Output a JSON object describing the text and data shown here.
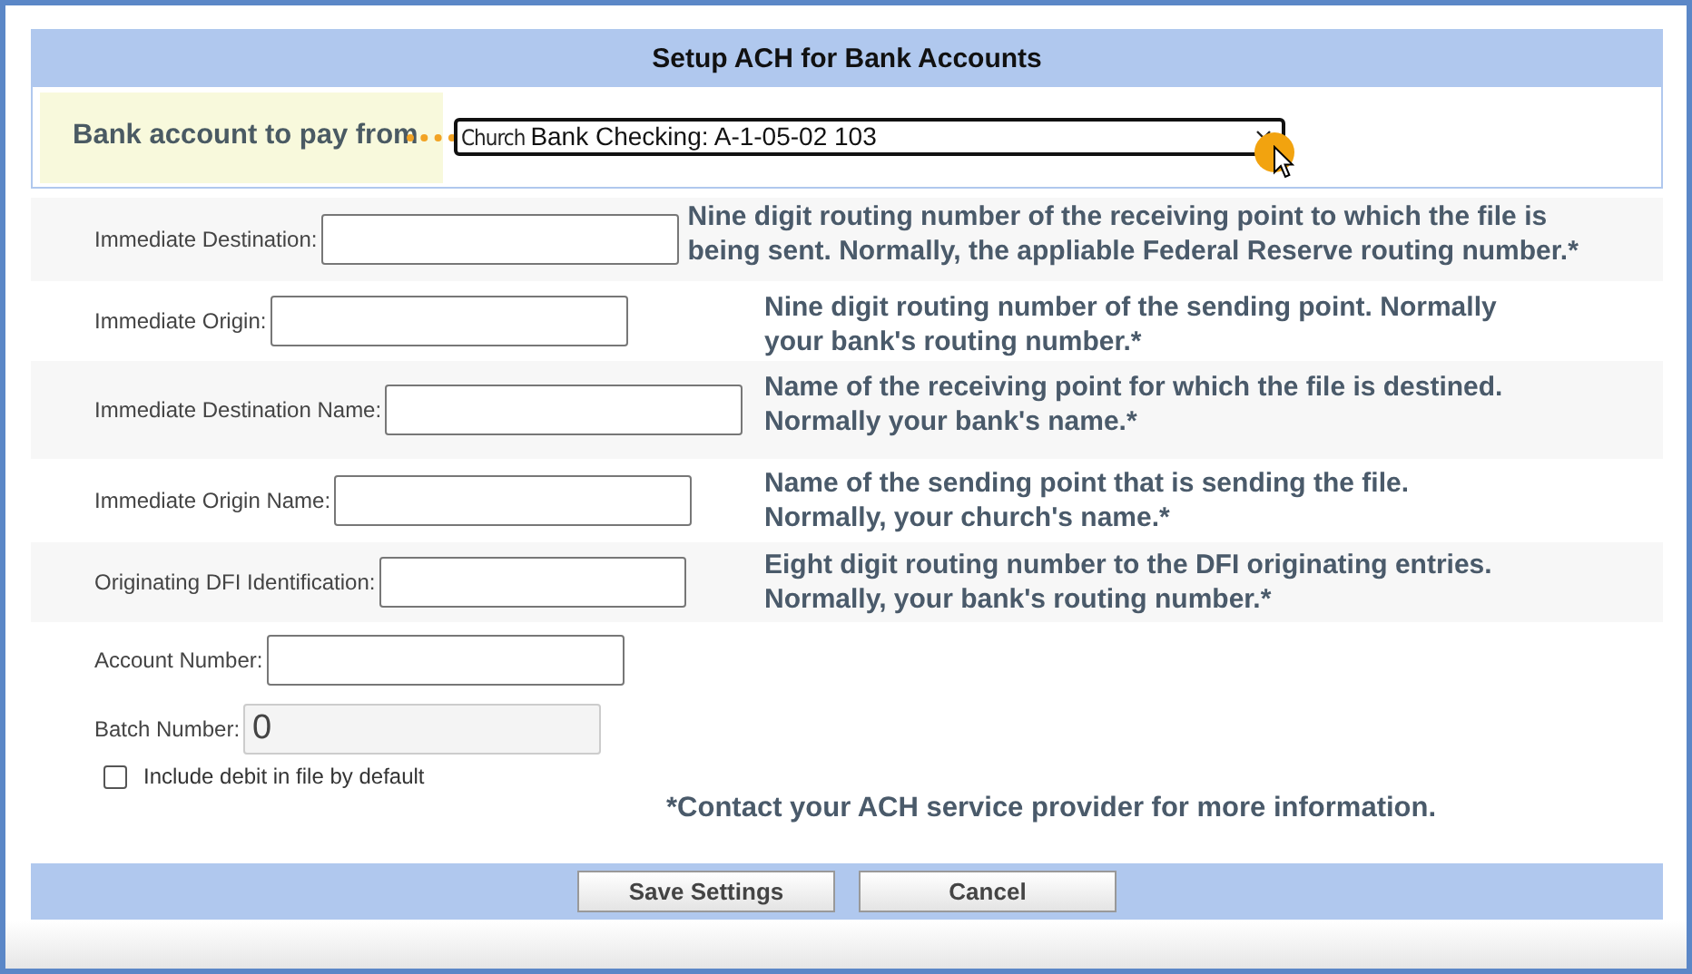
{
  "title": "Setup ACH for Bank Accounts",
  "bank_account": {
    "label": "Bank account to pay from",
    "value_prefix": "Church",
    "value": "Bank Checking: A-1-05-02 103"
  },
  "fields": [
    {
      "label": "Immediate Destination:",
      "disabled": false,
      "help": [
        "Nine digit routing number of the receiving point to which the file is",
        "being sent. Normally, the appliable Federal Reserve routing number.*"
      ]
    },
    {
      "label": "Immediate Origin:",
      "disabled": false,
      "help": [
        "Nine digit routing number of the sending point. Normally",
        "your bank's routing number.*"
      ]
    },
    {
      "label": "Immediate Destination Name:",
      "disabled": false,
      "help": [
        "Name of the receiving point for which the file is destined.",
        "Normally your bank's name.*"
      ]
    },
    {
      "label": "Immediate Origin Name:",
      "disabled": false,
      "help": [
        "Name of the sending point that is sending the file.",
        "Normally, your church's name.*"
      ]
    },
    {
      "label": "Originating DFI Identification:",
      "disabled": false,
      "help": [
        "Eight digit routing number to the DFI originating entries.",
        "Normally, your bank's routing number.*"
      ]
    },
    {
      "label": "Account Number:",
      "disabled": false
    },
    {
      "label": "Batch Number:",
      "value": "0",
      "disabled": true
    }
  ],
  "include_debit": {
    "label": "Include debit in file by default",
    "checked": false
  },
  "footnote": "*Contact your ACH service provider for more information.",
  "buttons": [
    "Save Settings",
    "Cancel"
  ]
}
